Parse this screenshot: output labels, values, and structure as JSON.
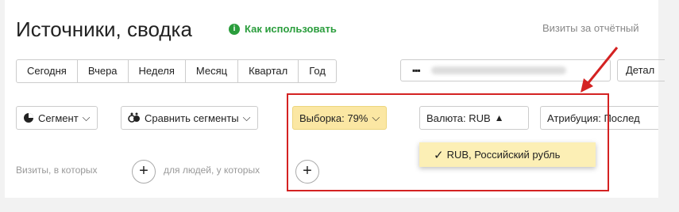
{
  "header": {
    "title": "Источники, сводка",
    "howto_icon": "info-dot-icon",
    "howto_label": "Как использовать",
    "visits_label": "Визиты за отчётный"
  },
  "periods": [
    "Сегодня",
    "Вчера",
    "Неделя",
    "Месяц",
    "Квартал",
    "Год"
  ],
  "daterange": {
    "icon": "calendar-icon",
    "value": ""
  },
  "detail_label": "Детал",
  "filters": {
    "segment_label": "Сегмент",
    "compare_label": "Сравнить сегменты",
    "sample_label": "Выборка: 79%",
    "currency_label": "Валюта: RUB",
    "attribution_label": "Атрибуция: Послед"
  },
  "currency_dropdown": {
    "options": [
      {
        "label": "RUB, Российский рубль",
        "selected": true
      }
    ]
  },
  "conditions": {
    "visits_text": "Визиты, в которых",
    "people_text": "для людей, у которых"
  },
  "colors": {
    "accent_green": "#2a9d3c",
    "sample_bg": "#fbe7a3",
    "dropdown_bg": "#fcefb5",
    "annotation_red": "#d42222"
  }
}
